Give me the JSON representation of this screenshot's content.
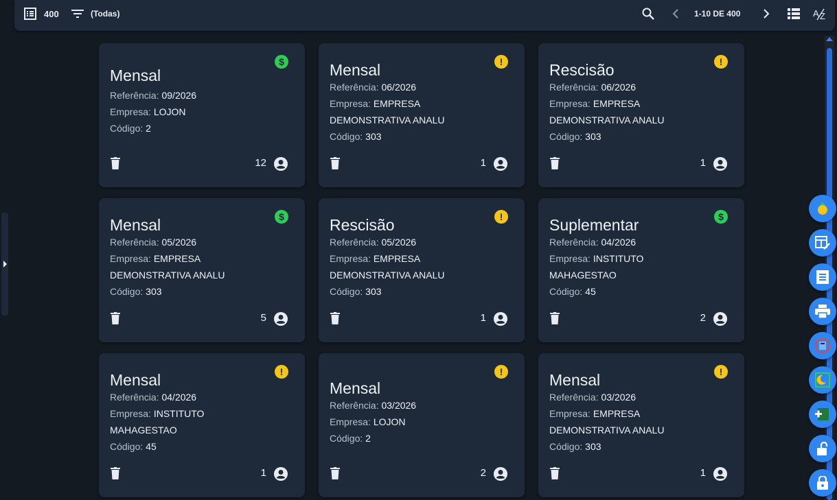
{
  "toolbar": {
    "count": "400",
    "filter": "(Todas)",
    "pagination": "1-10 DE 400",
    "icons": [
      "list-icon",
      "filter-icon",
      "search-icon",
      "prev-icon",
      "next-icon",
      "view-list-icon",
      "sort-az-icon"
    ]
  },
  "labels": {
    "referencia": "Referência:",
    "empresa": "Empresa:",
    "codigo": "Código:"
  },
  "cards": [
    {
      "title": "Mensal",
      "status": "paid",
      "referencia": "09/2026",
      "empresa": "LOJON",
      "empresa2": "",
      "codigo": "2",
      "count": "12"
    },
    {
      "title": "Mensal",
      "status": "warn",
      "referencia": "06/2026",
      "empresa": "EMPRESA",
      "empresa2": "DEMONSTRATIVA ANALU",
      "codigo": "303",
      "count": "1"
    },
    {
      "title": "Rescisão",
      "status": "warn",
      "referencia": "06/2026",
      "empresa": "EMPRESA",
      "empresa2": "DEMONSTRATIVA ANALU",
      "codigo": "303",
      "count": "1"
    },
    {
      "title": "Mensal",
      "status": "paid",
      "referencia": "05/2026",
      "empresa": "EMPRESA",
      "empresa2": "DEMONSTRATIVA ANALU",
      "codigo": "303",
      "count": "5"
    },
    {
      "title": "Rescisão",
      "status": "warn",
      "referencia": "05/2026",
      "empresa": "EMPRESA",
      "empresa2": "DEMONSTRATIVA ANALU",
      "codigo": "303",
      "count": "1"
    },
    {
      "title": "Suplementar",
      "status": "paid",
      "referencia": "04/2026",
      "empresa": "INSTITUTO",
      "empresa2": "MAHAGESTAO",
      "codigo": "45",
      "count": "2"
    },
    {
      "title": "Mensal",
      "status": "warn",
      "referencia": "04/2026",
      "empresa": "INSTITUTO",
      "empresa2": "MAHAGESTAO",
      "codigo": "45",
      "count": "1"
    },
    {
      "title": "Mensal",
      "status": "warn",
      "referencia": "03/2026",
      "empresa": "LOJON",
      "empresa2": "",
      "codigo": "2",
      "count": "2"
    },
    {
      "title": "Mensal",
      "status": "warn",
      "referencia": "03/2026",
      "empresa": "EMPRESA",
      "empresa2": "DEMONSTRATIVA ANALU",
      "codigo": "303",
      "count": "1"
    }
  ],
  "fabs": [
    "coin-bag-icon",
    "table-edit-icon",
    "receipt-icon",
    "printer-icon",
    "calculator-icon",
    "moon-icon",
    "add-document-icon",
    "unlock-icon",
    "lock-icon"
  ],
  "colors": {
    "background": "#141a22",
    "card": "#1e2a3a",
    "paid": "#2ecc55",
    "warn": "#f5c518",
    "fab": "#2f86f0"
  }
}
